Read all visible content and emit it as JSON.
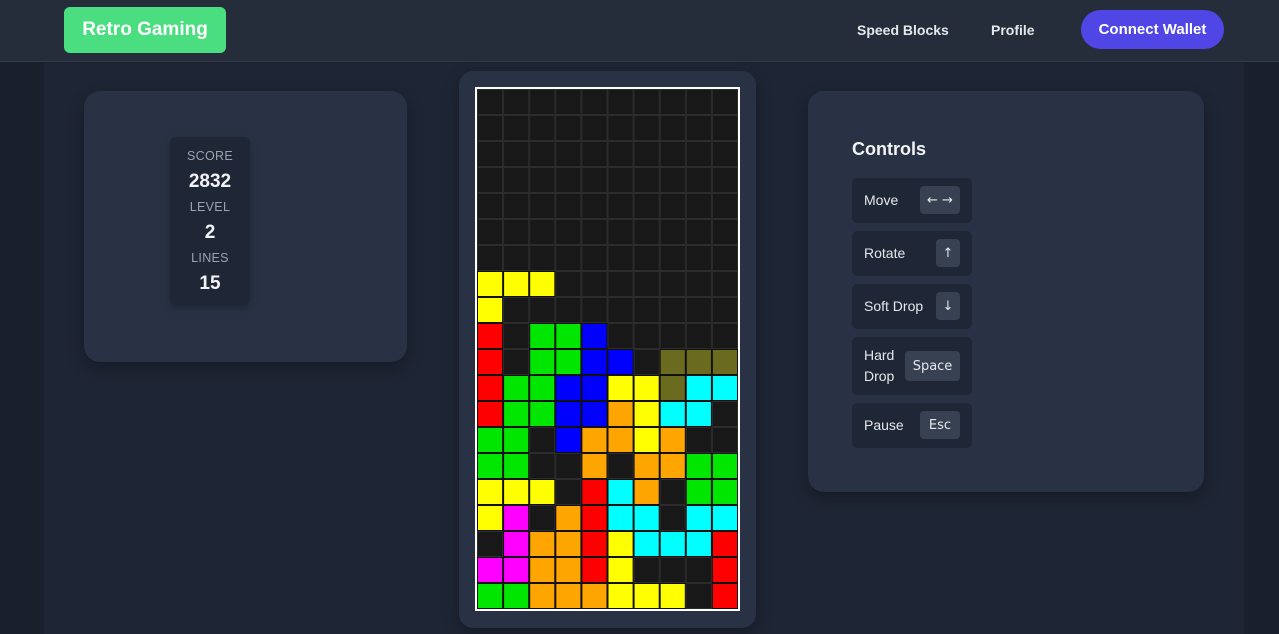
{
  "header": {
    "brand": "Retro Gaming",
    "nav": [
      "Speed Blocks",
      "Profile"
    ],
    "wallet_button": "Connect Wallet"
  },
  "stats": {
    "score_label": "SCORE",
    "score": "2832",
    "level_label": "LEVEL",
    "level": "2",
    "lines_label": "LINES",
    "lines": "15"
  },
  "controls": {
    "title": "Controls",
    "items": [
      {
        "label": "Move",
        "key": "← →"
      },
      {
        "label": "Rotate",
        "key": "↑"
      },
      {
        "label": "Soft Drop",
        "key": "↓"
      },
      {
        "label": "Hard Drop",
        "key": "Space"
      },
      {
        "label": "Pause",
        "key": "Esc"
      }
    ]
  },
  "board": {
    "cols": 10,
    "rows": 20,
    "palette": {
      "R": "#ff0000",
      "G": "#00e600",
      "B": "#0000ff",
      "Y": "#ffff00",
      "C": "#00ffff",
      "O": "#ffa500",
      "M": "#ff00ff",
      "D": "#6b6b1f"
    },
    "grid": [
      "..........",
      "..........",
      "..........",
      "..........",
      "..........",
      "..........",
      "..........",
      "YYY.......",
      "Y.........",
      "R.GGB.....",
      "R.GGBB.DDD",
      "RGGBBYYDCC",
      "RGGBBOYCC.",
      "GG.BOOYO..",
      "GG..O.OOGG",
      "YYY.RCO.GG",
      "YM.ORCC.CC",
      ".MOORYCCCR",
      "MMOORY...R",
      "GGOOOYYY.R"
    ]
  }
}
